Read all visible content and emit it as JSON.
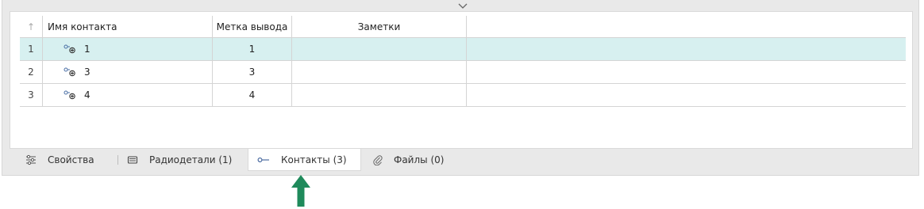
{
  "grid": {
    "columns": [
      "Имя контакта",
      "Метка вывода",
      "Заметки"
    ],
    "rows": [
      {
        "num": "1",
        "name": "1",
        "label": "1",
        "notes": ""
      },
      {
        "num": "2",
        "name": "3",
        "label": "3",
        "notes": ""
      },
      {
        "num": "3",
        "name": "4",
        "label": "4",
        "notes": ""
      }
    ],
    "selected_row": 0
  },
  "tabs": [
    {
      "label": "Свойства",
      "icon": "sliders-icon"
    },
    {
      "label": "Радиодетали (1)",
      "icon": "chip-icon"
    },
    {
      "label": "Контакты (3)",
      "icon": "pin-icon"
    },
    {
      "label": "Файлы (0)",
      "icon": "paperclip-icon"
    }
  ],
  "active_tab": "Контакты (3)",
  "colors": {
    "selected_row": "#d7f0f0",
    "arrow": "#1f8a5b"
  }
}
